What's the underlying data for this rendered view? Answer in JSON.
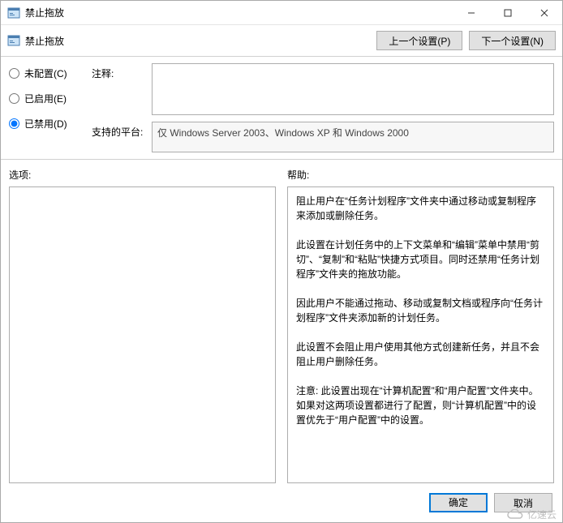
{
  "titlebar": {
    "title": "禁止拖放"
  },
  "toolbar": {
    "label": "禁止拖放",
    "prev": "上一个设置(P)",
    "next": "下一个设置(N)"
  },
  "radio": {
    "not_configured": "未配置(C)",
    "enabled": "已启用(E)",
    "disabled": "已禁用(D)",
    "selected": "disabled"
  },
  "fields": {
    "comment_label": "注释:",
    "comment_value": "",
    "platform_label": "支持的平台:",
    "platform_value": "仅 Windows Server 2003、Windows XP 和 Windows 2000"
  },
  "panels": {
    "options_label": "选项:",
    "help_label": "帮助:",
    "help_text": "阻止用户在“任务计划程序”文件夹中通过移动或复制程序来添加或删除任务。\n\n此设置在计划任务中的上下文菜单和“编辑”菜单中禁用“剪切”、“复制”和“粘贴”快捷方式项目。同时还禁用“任务计划程序”文件夹的拖放功能。\n\n因此用户不能通过拖动、移动或复制文档或程序向“任务计划程序”文件夹添加新的计划任务。\n\n此设置不会阻止用户使用其他方式创建新任务，并且不会阻止用户删除任务。\n\n注意: 此设置出现在“计算机配置”和“用户配置”文件夹中。如果对这两项设置都进行了配置，则“计算机配置”中的设置优先于“用户配置”中的设置。"
  },
  "buttons": {
    "ok": "确定",
    "cancel": "取消"
  },
  "watermark": {
    "text": "亿速云"
  },
  "icons": {
    "app": "gpo-icon"
  }
}
